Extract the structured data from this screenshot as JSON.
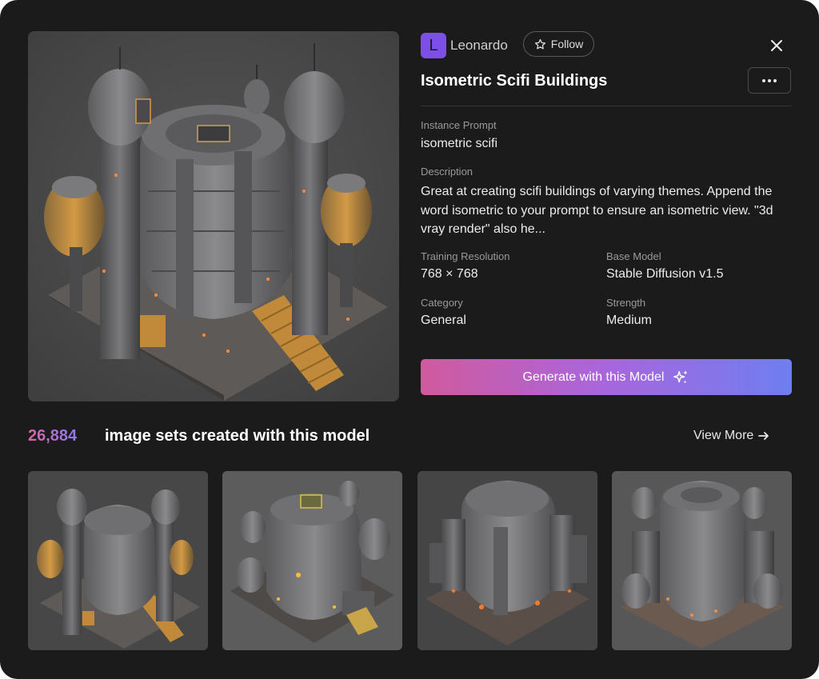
{
  "header": {
    "avatar_letter": "L",
    "creator_name": "Leonardo",
    "follow_label": "Follow",
    "title": "Isometric Scifi Buildings"
  },
  "details": {
    "instance_prompt_label": "Instance Prompt",
    "instance_prompt": "isometric scifi",
    "description_label": "Description",
    "description": "Great at creating scifi buildings of varying themes. Append the word isometric to your prompt to ensure an isometric view. \"3d vray render\" also he...",
    "training_resolution_label": "Training Resolution",
    "training_resolution": "768 × 768",
    "base_model_label": "Base Model",
    "base_model": "Stable Diffusion v1.5",
    "category_label": "Category",
    "category": "General",
    "strength_label": "Strength",
    "strength": "Medium"
  },
  "generate_label": "Generate with this Model",
  "gallery": {
    "count": "26,884",
    "count_text": "image sets created with this model",
    "view_more": "View More"
  },
  "icons": {
    "close": "close-icon",
    "more": "more-icon",
    "follow": "star-icon",
    "generate": "sparkle-icon",
    "view_more": "arrow-right-icon"
  },
  "colors": {
    "background": "#1b1b1c",
    "avatar": "#7c4fe8",
    "gradient_start": "#d15a9d",
    "gradient_end": "#6e7ef0"
  }
}
